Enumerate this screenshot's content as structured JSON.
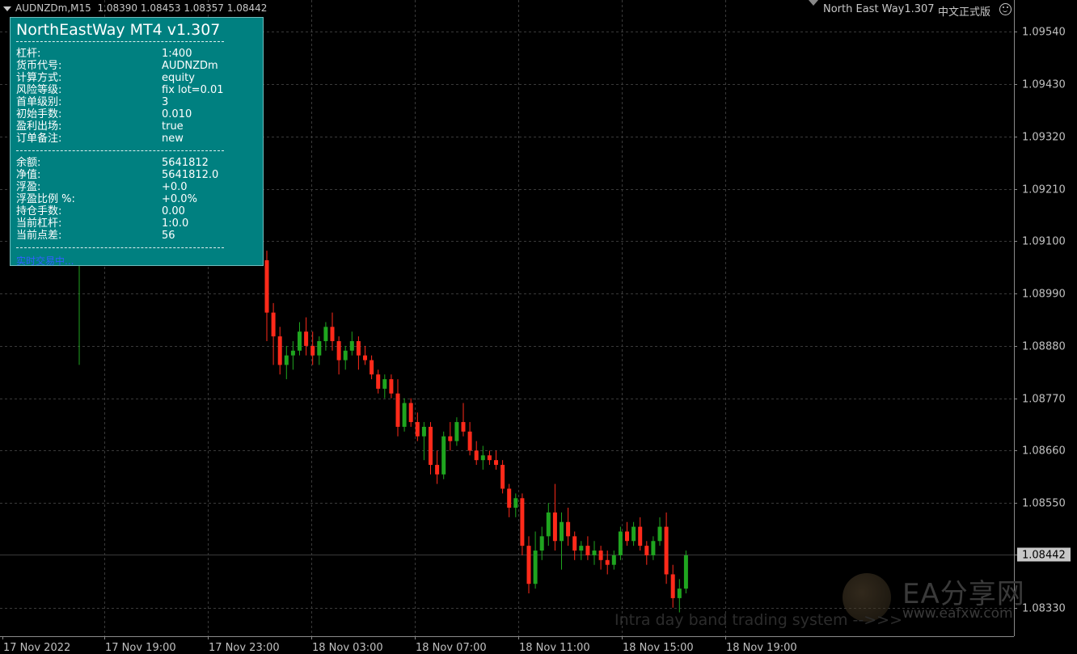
{
  "symbol_bar": {
    "label": "AUDNZDm,M15",
    "ohlc": "1.08390 1.08453 1.08357 1.08442"
  },
  "top_right": {
    "ea_name": "North East Way1.307",
    "edition": "中文正式版"
  },
  "panel": {
    "title": "NorthEastWay MT4 v1.307",
    "settings": [
      {
        "k": "杠杆:",
        "v": "1:400"
      },
      {
        "k": "货币代号:",
        "v": "AUDNZDm"
      },
      {
        "k": "计算方式:",
        "v": "equity"
      },
      {
        "k": "风险等级:",
        "v": "fix lot=0.01"
      },
      {
        "k": "首单级别:",
        "v": "3"
      },
      {
        "k": "初始手数:",
        "v": "0.010"
      },
      {
        "k": "盈利出场:",
        "v": "true"
      },
      {
        "k": "订单备注:",
        "v": "new"
      }
    ],
    "account": [
      {
        "k": "余额:",
        "v": "5641812"
      },
      {
        "k": "净值:",
        "v": "5641812.0"
      },
      {
        "k": "浮盈:",
        "v": "+0.0"
      },
      {
        "k": "浮盈比例 %:",
        "v": "+0.0%"
      },
      {
        "k": "持仓手数:",
        "v": "0.00"
      },
      {
        "k": "当前杠杆:",
        "v": "1:0.0"
      },
      {
        "k": "当前点差:",
        "v": "56"
      }
    ],
    "status": "实时交易中..."
  },
  "watermark": {
    "brand": "EA分享网",
    "url": "www.eafxw.com",
    "ad": "Intra day band trading system -->>>"
  },
  "colors": {
    "background": "#000000",
    "bull": "#1fa51f",
    "bear": "#ff2a1a",
    "grid": "#3a3a3a",
    "panel": "#008080"
  },
  "chart_data": {
    "type": "candlestick",
    "symbol": "AUDNZDm",
    "timeframe": "M15",
    "ylim": [
      1.0827,
      1.096
    ],
    "y_ticks": [
      "1.09540",
      "1.09430",
      "1.09320",
      "1.09210",
      "1.09100",
      "1.08990",
      "1.08880",
      "1.08770",
      "1.08660",
      "1.08550",
      "1.08442",
      "1.08330"
    ],
    "current_price": "1.08442",
    "x_ticks": [
      "17 Nov 2022",
      "17 Nov 19:00",
      "17 Nov 23:00",
      "18 Nov 03:00",
      "18 Nov 07:00",
      "18 Nov 11:00",
      "18 Nov 15:00",
      "18 Nov 19:00"
    ],
    "grid": true,
    "candles": [
      [
        1.0913,
        1.0916,
        1.0884,
        1.0913
      ],
      [
        1.0906,
        1.0908,
        1.0889,
        1.0895
      ],
      [
        1.0895,
        1.0897,
        1.0884,
        1.089
      ],
      [
        1.089,
        1.0892,
        1.0882,
        1.0884
      ],
      [
        1.0884,
        1.0888,
        1.0881,
        1.0886
      ],
      [
        1.0886,
        1.0889,
        1.0883,
        1.0887
      ],
      [
        1.0887,
        1.0893,
        1.0886,
        1.0891
      ],
      [
        1.0891,
        1.0894,
        1.0886,
        1.0888
      ],
      [
        1.0888,
        1.0891,
        1.0884,
        1.0886
      ],
      [
        1.0886,
        1.089,
        1.0884,
        1.0889
      ],
      [
        1.0889,
        1.0893,
        1.0887,
        1.0892
      ],
      [
        1.0892,
        1.0895,
        1.0887,
        1.0889
      ],
      [
        1.0889,
        1.089,
        1.0882,
        1.0885
      ],
      [
        1.0885,
        1.0888,
        1.0883,
        1.0887
      ],
      [
        1.0887,
        1.0891,
        1.0886,
        1.0889
      ],
      [
        1.0889,
        1.089,
        1.0883,
        1.0886
      ],
      [
        1.0886,
        1.0888,
        1.0884,
        1.0885
      ],
      [
        1.0885,
        1.0886,
        1.0881,
        1.0882
      ],
      [
        1.0882,
        1.0883,
        1.0878,
        1.0879
      ],
      [
        1.0879,
        1.0882,
        1.0877,
        1.0881
      ],
      [
        1.0881,
        1.0882,
        1.0877,
        1.0878
      ],
      [
        1.0878,
        1.0881,
        1.0869,
        1.0871
      ],
      [
        1.0871,
        1.0877,
        1.087,
        1.0876
      ],
      [
        1.0876,
        1.0877,
        1.0871,
        1.0872
      ],
      [
        1.0872,
        1.0874,
        1.0868,
        1.0869
      ],
      [
        1.0869,
        1.0872,
        1.0864,
        1.0871
      ],
      [
        1.0871,
        1.0872,
        1.0861,
        1.0863
      ],
      [
        1.0863,
        1.0866,
        1.0859,
        1.0861
      ],
      [
        1.0861,
        1.087,
        1.086,
        1.0869
      ],
      [
        1.0869,
        1.0872,
        1.0866,
        1.0868
      ],
      [
        1.0868,
        1.0873,
        1.0867,
        1.0872
      ],
      [
        1.0872,
        1.0876,
        1.0869,
        1.087
      ],
      [
        1.087,
        1.0872,
        1.0865,
        1.0866
      ],
      [
        1.0866,
        1.0868,
        1.0863,
        1.0864
      ],
      [
        1.0864,
        1.0867,
        1.0862,
        1.0865
      ],
      [
        1.0865,
        1.0866,
        1.0863,
        1.0864
      ],
      [
        1.0864,
        1.0866,
        1.0862,
        1.0863
      ],
      [
        1.0863,
        1.0864,
        1.0857,
        1.0858
      ],
      [
        1.0858,
        1.0859,
        1.0852,
        1.0854
      ],
      [
        1.0854,
        1.0857,
        1.0852,
        1.0856
      ],
      [
        1.0856,
        1.0857,
        1.0844,
        1.0846
      ],
      [
        1.0846,
        1.0848,
        1.0836,
        1.0838
      ],
      [
        1.0838,
        1.0849,
        1.0837,
        1.0845
      ],
      [
        1.0845,
        1.085,
        1.0843,
        1.0848
      ],
      [
        1.0848,
        1.0855,
        1.0846,
        1.0853
      ],
      [
        1.0853,
        1.0859,
        1.0845,
        1.0847
      ],
      [
        1.0847,
        1.0853,
        1.0841,
        1.0851
      ],
      [
        1.0851,
        1.0854,
        1.0846,
        1.0848
      ],
      [
        1.0848,
        1.0849,
        1.0843,
        1.0845
      ],
      [
        1.0845,
        1.0847,
        1.0843,
        1.0846
      ],
      [
        1.0846,
        1.0848,
        1.0843,
        1.0844
      ],
      [
        1.0844,
        1.0847,
        1.0842,
        1.0845
      ],
      [
        1.0845,
        1.0846,
        1.0841,
        1.0843
      ],
      [
        1.0843,
        1.0845,
        1.084,
        1.0842
      ],
      [
        1.0842,
        1.0845,
        1.0841,
        1.0844
      ],
      [
        1.0844,
        1.085,
        1.0843,
        1.0849
      ],
      [
        1.0849,
        1.0851,
        1.0846,
        1.0847
      ],
      [
        1.0847,
        1.0851,
        1.0846,
        1.085
      ],
      [
        1.085,
        1.0852,
        1.0845,
        1.0846
      ],
      [
        1.0846,
        1.0847,
        1.0842,
        1.0844
      ],
      [
        1.0844,
        1.0848,
        1.0843,
        1.0847
      ],
      [
        1.0847,
        1.0852,
        1.0846,
        1.085
      ],
      [
        1.085,
        1.0853,
        1.0838,
        1.084
      ],
      [
        1.084,
        1.0842,
        1.0833,
        1.0835
      ],
      [
        1.0835,
        1.0839,
        1.0832,
        1.0837
      ],
      [
        1.0837,
        1.0845,
        1.0836,
        1.0844
      ]
    ]
  }
}
